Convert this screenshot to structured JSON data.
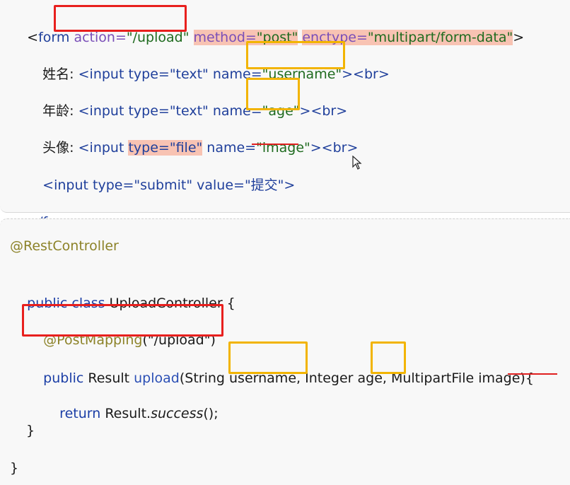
{
  "html_code": {
    "line1": {
      "open": "<",
      "tag": "form",
      "action_attr": "action=",
      "action_val": "\"/upload\"",
      "method_attr": "method=",
      "method_val": "\"post\"",
      "enctype_attr": "enctype=",
      "enctype_val": "\"multipart/form-data\"",
      "close": ">"
    },
    "line2": {
      "label": "姓名: ",
      "code": "<input type=\"text\" name=",
      "name_val": "\"username\"",
      "end": "><br>"
    },
    "line3": {
      "label": "年龄: ",
      "code": "<input type=\"text\" name=",
      "name_val": "\"age\"",
      "end": "><br>"
    },
    "line4": {
      "label": "头像: ",
      "code_a": "<input ",
      "type_attr": "type=\"file\"",
      "code_b": " name=",
      "name_val": "\"image\"",
      "end": "><br>"
    },
    "line5": {
      "code": "<input type=\"submit\" value=\"提交\">"
    },
    "line6": {
      "code": "</form>"
    }
  },
  "java_code": {
    "line1": "@RestController",
    "line2": {
      "kw": "public class ",
      "name": "UploadController {"
    },
    "line3": {
      "ann": "@PostMapping",
      "args": "(\"/upload\")"
    },
    "line4": {
      "kw": "public ",
      "type1": "Result ",
      "method": "upload",
      "p1type": "(String ",
      "p1name": "username",
      "sep1": ", Integer ",
      "p2name": "age",
      "sep2": ", MultipartFile ",
      "p3name": "image",
      "end": "){"
    },
    "line5": {
      "kw": "return ",
      "obj": "Result.",
      "call": "success",
      "end": "();"
    },
    "line6": "}",
    "line7": "}"
  },
  "colors": {
    "red_box": "#e8201e",
    "yellow_box": "#f2b400",
    "highlight": "#f8c3b3"
  },
  "icons": {
    "cursor": "mouse-pointer-icon"
  }
}
